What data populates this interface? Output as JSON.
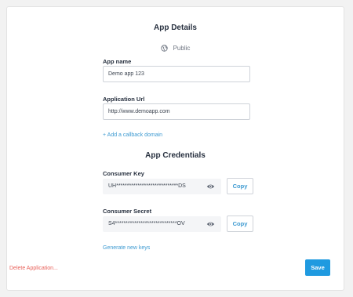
{
  "details": {
    "title": "App Details",
    "visibility": {
      "icon": "globe-icon",
      "label": "Public"
    },
    "app_name": {
      "label": "App name",
      "value": "Demo app 123"
    },
    "app_url": {
      "label": "Application Url",
      "value": "http://www.demoapp.com"
    },
    "add_callback": "+ Add a callback domain"
  },
  "credentials": {
    "title": "App Credentials",
    "consumer_key": {
      "label": "Consumer Key",
      "value": "UH*****************************DS",
      "reveal_icon": "eye-icon",
      "copy_label": "Copy"
    },
    "consumer_secret": {
      "label": "Consumer Secret",
      "value": "S4*****************************OV",
      "reveal_icon": "eye-icon",
      "copy_label": "Copy"
    },
    "generate_keys": "Generate new keys"
  },
  "footer": {
    "delete_label": "Delete Application...",
    "save_label": "Save"
  },
  "colors": {
    "accent": "#1f9ae0",
    "link": "#3d9ad1",
    "danger": "#e8615a"
  }
}
